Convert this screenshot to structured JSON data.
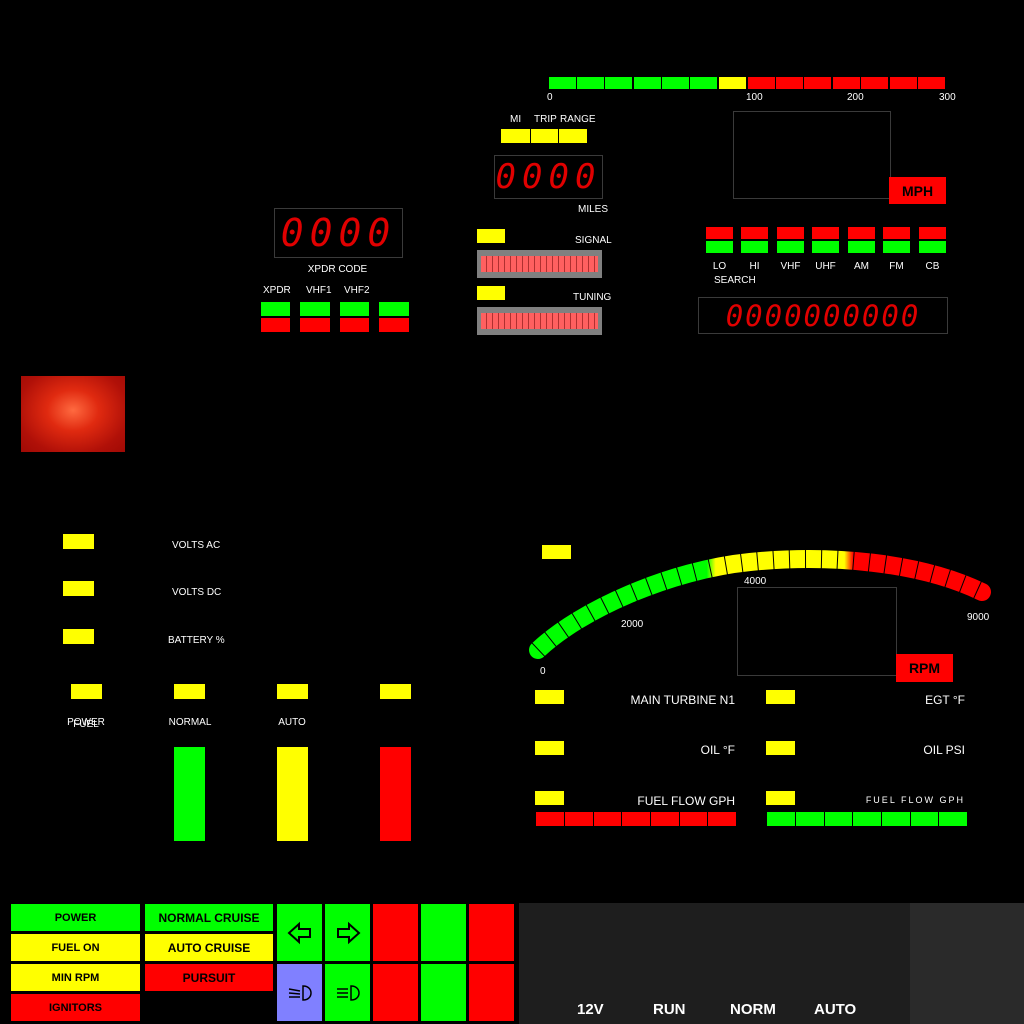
{
  "speed": {
    "scale": [
      "0",
      "100",
      "200",
      "300"
    ],
    "display_label": "MI",
    "trip_label": "TRIP",
    "range_label": "RANGE",
    "odometer": "0000",
    "odometer_unit": "MILES",
    "unit": "MPH"
  },
  "transponder": {
    "code": "0000",
    "caption": "XPDR CODE",
    "buttons": [
      "XPDR",
      "VHF1",
      "VHF2",
      ""
    ]
  },
  "radio": {
    "signal_label": "SIGNAL",
    "tuning_label": "TUNING",
    "bands": [
      "LO",
      "HI",
      "VHF",
      "UHF",
      "AM",
      "FM",
      "CB"
    ],
    "band_sub": "SEARCH",
    "frequency": "0000000000"
  },
  "electrical": {
    "labels": [
      "VOLTS AC",
      "VOLTS DC",
      "BATTERY %"
    ]
  },
  "modes": {
    "labels": [
      "POWER",
      "NORMAL",
      "AUTO",
      ""
    ],
    "sublabel": "FUEL"
  },
  "rpm": {
    "scale": [
      "0",
      "2000",
      "4000",
      "9000"
    ],
    "unit": "RPM"
  },
  "engine": {
    "labels_left": [
      "MAIN TURBINE N1",
      "OIL °F",
      "FUEL FLOW GPH"
    ],
    "labels_right": [
      "EGT °F",
      "OIL PSI",
      "FUEL FLOW GPH"
    ]
  },
  "bottom_panel": {
    "left_buttons": [
      "POWER",
      "FUEL ON",
      "MIN RPM",
      "IGNITORS"
    ],
    "mid_buttons": [
      "NORMAL CRUISE",
      "AUTO CRUISE",
      "PURSUIT"
    ],
    "status": [
      "12V",
      "RUN",
      "NORM",
      "AUTO"
    ]
  },
  "colors": {
    "ok": "#00ff00",
    "caution": "#ffff00",
    "warning": "#ff0000",
    "background": "#000000"
  }
}
